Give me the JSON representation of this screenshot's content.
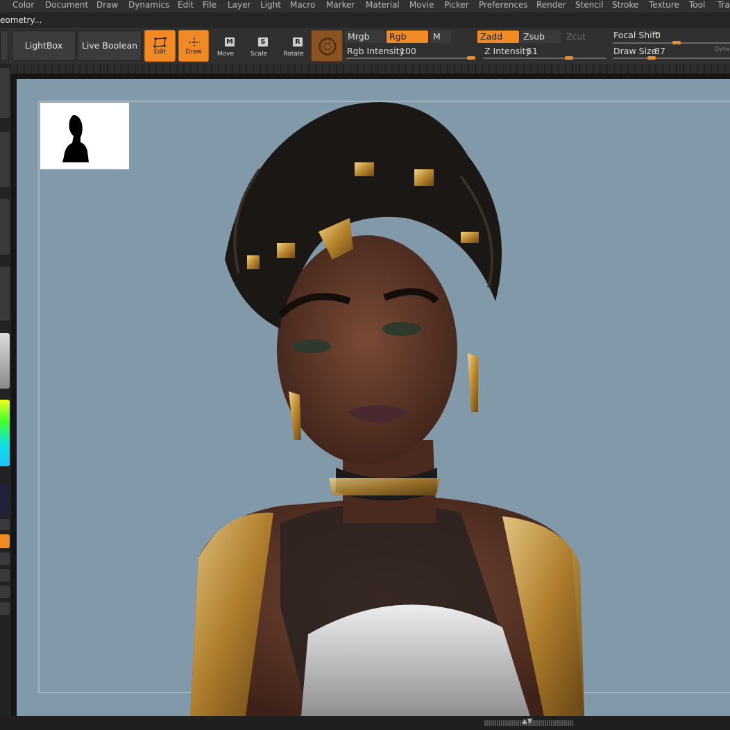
{
  "menu": {
    "items": [
      "Color",
      "Document",
      "Draw",
      "Dynamics",
      "Edit",
      "File",
      "Layer",
      "Light",
      "Macro",
      "Marker",
      "Material",
      "Movie",
      "Picker",
      "Preferences",
      "Render",
      "Stencil",
      "Stroke",
      "Texture",
      "Tool",
      "Tra"
    ]
  },
  "subbar": {
    "text": "eometry..."
  },
  "toolbar": {
    "lightbox_label": "LightBox",
    "live_boolean_label": "Live Boolean",
    "edit_label": "Edit",
    "draw_label": "Draw",
    "move_label": "Move",
    "scale_label": "Scale",
    "rotate_label": "Rotate",
    "move_key": "M",
    "scale_key": "S",
    "rotate_key": "R",
    "mrgb_label": "Mrgb",
    "rgb_label": "Rgb",
    "m_label": "M",
    "rgb_intensity_label": "Rgb Intensity",
    "rgb_intensity_value": "100",
    "rgb_intensity_fraction": 1.0,
    "zadd_label": "Zadd",
    "zsub_label": "Zsub",
    "zcut_label": "Zcut",
    "z_intensity_label": "Z Intensity",
    "z_intensity_value": "51",
    "z_intensity_fraction": 0.51,
    "focal_shift_label": "Focal Shift",
    "focal_shift_value": "0",
    "draw_size_label": "Draw Size",
    "draw_size_value": "87",
    "dynamic_label": "Dyna"
  },
  "colors": {
    "accent": "#f08a24",
    "canvas_bg": "#8199a9",
    "panel": "#303030"
  }
}
